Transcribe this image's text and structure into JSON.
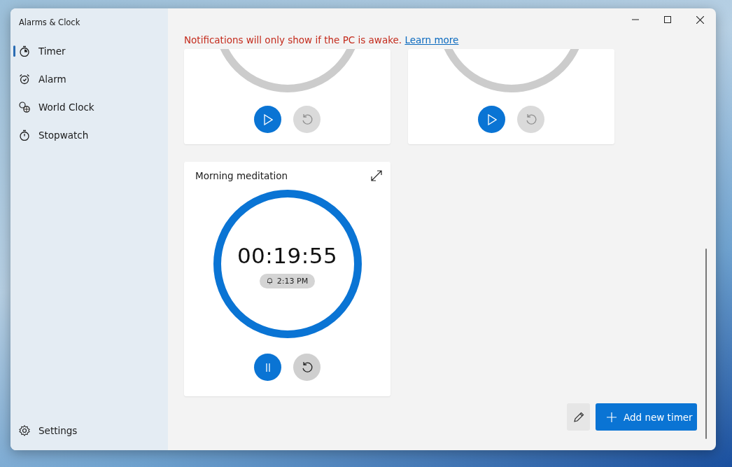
{
  "window": {
    "title": "Alarms & Clock"
  },
  "nav": [
    {
      "label": "Timer",
      "selected": true
    },
    {
      "label": "Alarm",
      "selected": false
    },
    {
      "label": "World Clock",
      "selected": false
    },
    {
      "label": "Stopwatch",
      "selected": false
    }
  ],
  "settings": {
    "label": "Settings"
  },
  "notice": {
    "text": "Notifications will only show if the PC is awake.",
    "link": "Learn more"
  },
  "timers": [
    {
      "kind": "clipped",
      "running": false,
      "reset_disabled": true
    },
    {
      "kind": "clipped",
      "running": false,
      "reset_disabled": true
    },
    {
      "kind": "full",
      "name": "Morning meditation",
      "time": "00:19:55",
      "ends": "2:13 PM",
      "running": true,
      "level": 1,
      "reset_disabled": false
    }
  ],
  "footer": {
    "add_button": "Add new timer"
  }
}
